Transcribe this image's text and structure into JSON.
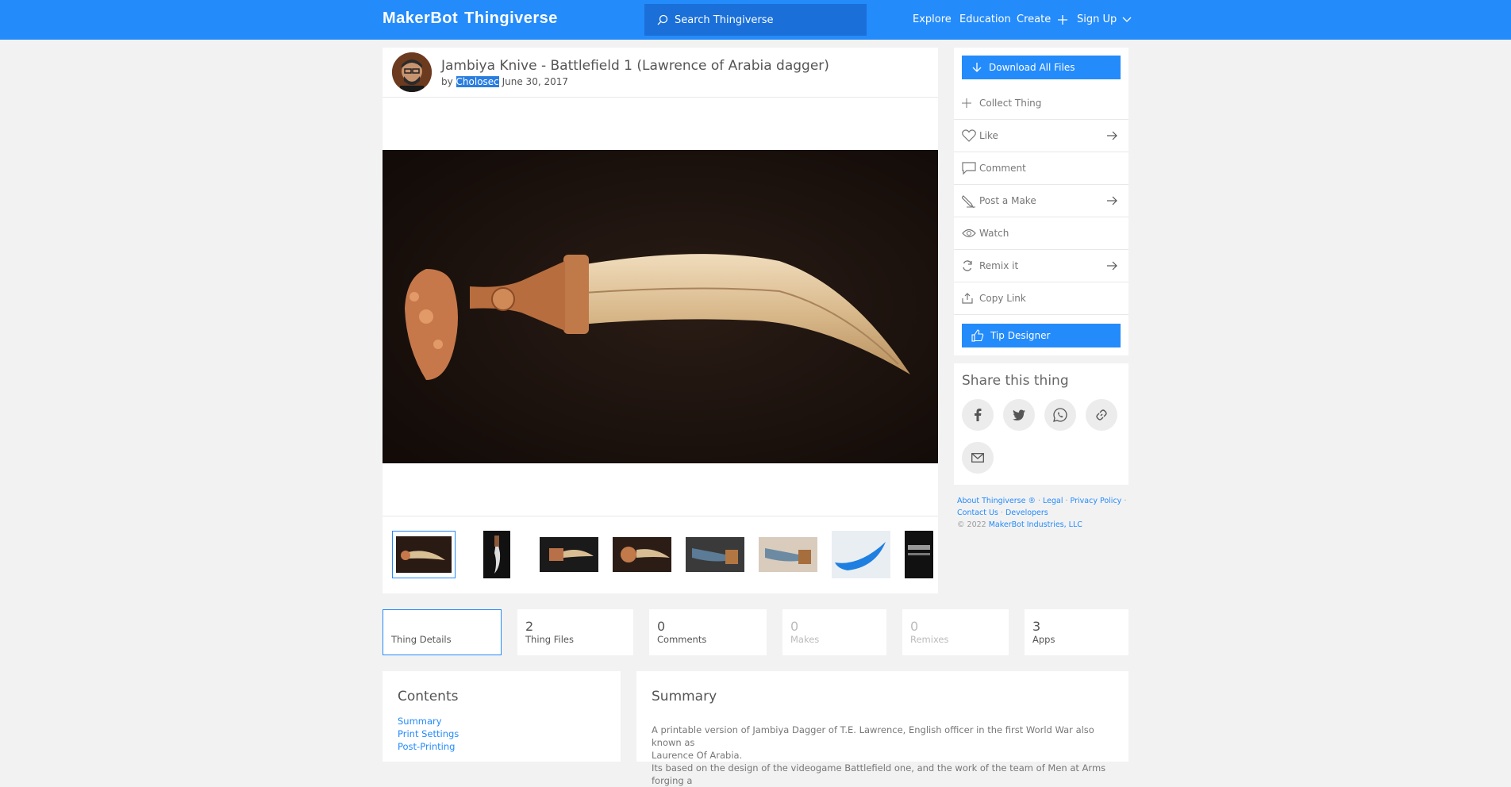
{
  "header": {
    "logo_makerbot": "MakerBot",
    "logo_thingiverse": "Thingiverse",
    "search_placeholder": "Search Thingiverse",
    "nav": [
      "Explore",
      "Education",
      "Create",
      "Sign Up"
    ]
  },
  "thing": {
    "title": "Jambiya Knive - Battlefield 1 (Lawrence of Arabia dagger)",
    "by": "by",
    "author": "Cholosec",
    "date": "June 30, 2017"
  },
  "sidebar": {
    "download_all": "Download All Files",
    "actions": [
      "Collect Thing",
      "Like",
      "Comment",
      "Post a Make",
      "Watch",
      "Remix it",
      "Copy Link"
    ],
    "tip": "Tip Designer",
    "share_title": "Share this thing"
  },
  "footer": {
    "about": "About Thingiverse ®",
    "legal": "Legal",
    "privacy": "Privacy Policy",
    "contact": "Contact Us",
    "developers": "Developers",
    "copyright_prefix": "© 2022",
    "company": "MakerBot Industries, LLC"
  },
  "tabs": [
    {
      "num": "",
      "label": "Thing Details"
    },
    {
      "num": "2",
      "label": "Thing Files"
    },
    {
      "num": "0",
      "label": "Comments"
    },
    {
      "num": "0",
      "label": "Makes"
    },
    {
      "num": "0",
      "label": "Remixes"
    },
    {
      "num": "3",
      "label": "Apps"
    }
  ],
  "contents": {
    "title": "Contents",
    "links": [
      "Summary",
      "Print Settings",
      "Post-Printing"
    ]
  },
  "summary": {
    "title": "Summary",
    "line1": "A printable version of Jambiya Dagger of T.E. Lawrence, English officer in the first World War also known as",
    "line2": "Laurence Of Arabia.",
    "line3": "Its based on the design of the videogame Battlefield one, and the work of the team of Men at Arms forging a"
  },
  "colors": {
    "brand_blue": "#248bfb",
    "search_bg": "#1a6fd9",
    "page_bg": "#f2f2f2"
  }
}
